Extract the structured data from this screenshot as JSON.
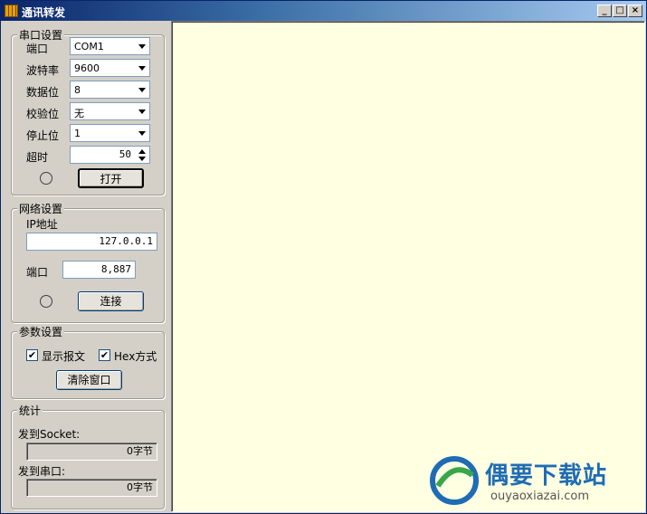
{
  "window": {
    "title": "通讯转发",
    "minimize_label": "_",
    "maximize_label": "□",
    "close_label": "×"
  },
  "serial": {
    "group_title": "串口设置",
    "port_label": "端口",
    "port_value": "COM1",
    "baud_label": "波特率",
    "baud_value": "9600",
    "databits_label": "数据位",
    "databits_value": "8",
    "parity_label": "校验位",
    "parity_value": "无",
    "stopbits_label": "停止位",
    "stopbits_value": "1",
    "timeout_label": "超时",
    "timeout_value": "50",
    "open_button": "打开"
  },
  "network": {
    "group_title": "网络设置",
    "ip_label": "IP地址",
    "ip_value": "127.0.0.1",
    "port_label": "端口",
    "port_value": "8,887",
    "connect_button": "连接"
  },
  "params": {
    "group_title": "参数设置",
    "show_message_label": "显示报文",
    "show_message_checked": true,
    "hex_mode_label": "Hex方式",
    "hex_mode_checked": true,
    "clear_button": "清除窗口"
  },
  "stats": {
    "group_title": "统计",
    "to_socket_label": "发到Socket:",
    "to_socket_value": "0字节",
    "to_serial_label": "发到串口:",
    "to_serial_value": "0字节"
  },
  "content": {
    "background_color": "#ffffe1"
  },
  "watermark": {
    "title": "偶要下载站",
    "url": "ouyaoxiazai.com"
  }
}
